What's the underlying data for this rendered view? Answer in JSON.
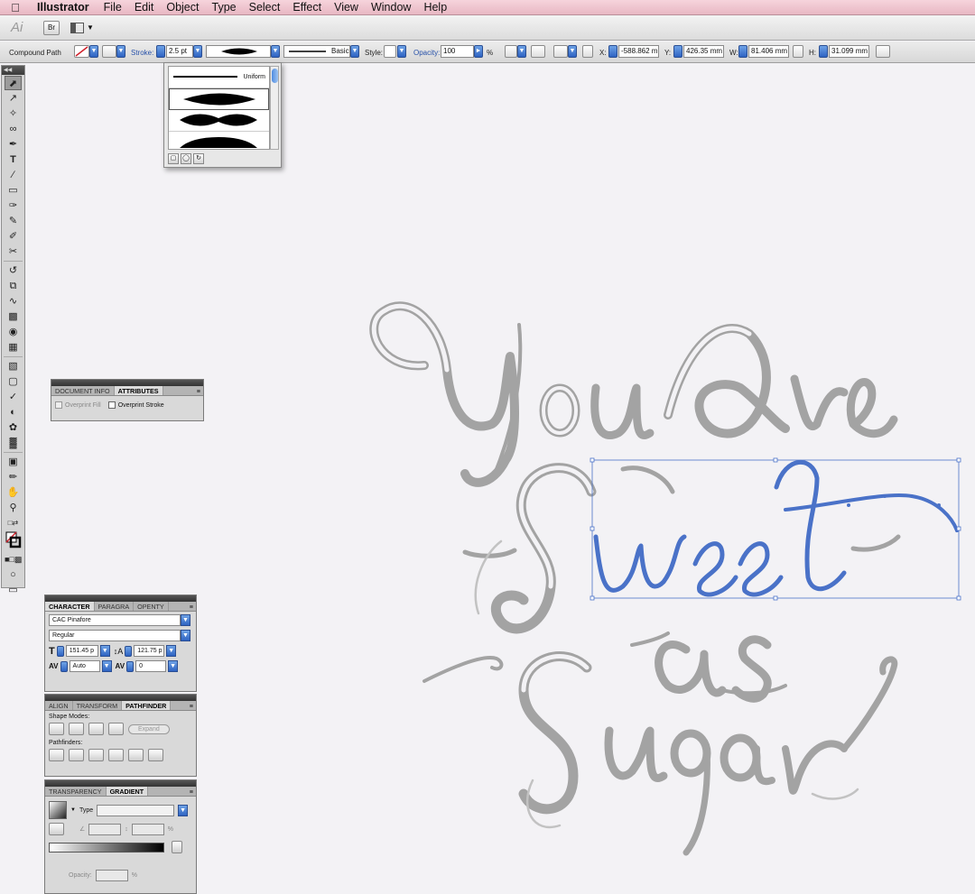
{
  "menubar": {
    "app_name": "Illustrator",
    "items": [
      "File",
      "Edit",
      "Object",
      "Type",
      "Select",
      "Effect",
      "View",
      "Window",
      "Help"
    ]
  },
  "appbar": {
    "logo": "Ai",
    "bridge_label": "Br"
  },
  "control": {
    "selection_type": "Compound Path",
    "stroke_label": "Stroke:",
    "stroke_weight": "2.5 pt",
    "brush_label": "Basic",
    "style_label": "Style:",
    "opacity_label": "Opacity:",
    "opacity_value": "100",
    "opacity_unit": "%",
    "x_label": "X:",
    "x_value": "-588.862 m",
    "y_label": "Y:",
    "y_value": "426.35 mm",
    "w_label": "W:",
    "w_value": "81.406 mm",
    "h_label": "H:",
    "h_value": "31.099 mm"
  },
  "profile_popup": {
    "uniform_label": "Uniform"
  },
  "attributes_panel": {
    "tabs": [
      "DOCUMENT INFO",
      "ATTRIBUTES"
    ],
    "overprint_fill": "Overprint Fill",
    "overprint_stroke": "Overprint Stroke"
  },
  "character_panel": {
    "tabs": [
      "CHARACTER",
      "PARAGRA",
      "OPENTY"
    ],
    "font_family": "CAC Pinafore",
    "font_style": "Regular",
    "font_size": "151.45 p",
    "leading": "121.75 p",
    "kerning": "Auto",
    "tracking": "0"
  },
  "pathfinder_panel": {
    "tabs": [
      "ALIGN",
      "TRANSFORM",
      "PATHFINDER"
    ],
    "shape_modes_label": "Shape Modes:",
    "expand_label": "Expand",
    "pathfinders_label": "Pathfinders:"
  },
  "gradient_panel": {
    "tabs": [
      "TRANSPARENCY",
      "GRADIENT"
    ],
    "type_label": "Type",
    "percent_symbol": "%",
    "opacity_label": "Opacity:"
  },
  "colors": {
    "selection_blue": "#4a72c8",
    "menubar_pink": "#efc3cf",
    "lettering_gray": "#a3a3a3"
  }
}
